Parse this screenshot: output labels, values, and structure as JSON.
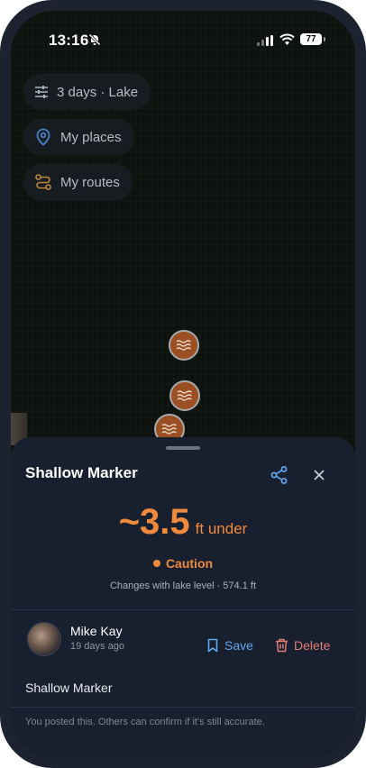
{
  "status": {
    "time": "13:16",
    "battery": "77"
  },
  "filters": [
    {
      "label": "3 days · Lake",
      "icon": "sliders-icon"
    },
    {
      "label": "My places",
      "icon": "pin-icon"
    },
    {
      "label": "My routes",
      "icon": "route-icon"
    }
  ],
  "map_markers": [
    {
      "icon": "waves-icon"
    },
    {
      "icon": "waves-icon"
    },
    {
      "icon": "waves-icon"
    }
  ],
  "sheet": {
    "title": "Shallow Marker",
    "depth_value": "~3.5",
    "depth_unit": "ft under",
    "status": "Caution",
    "changes": "Changes with lake level · 574.1 ft",
    "author": {
      "name": "Mike Kay",
      "ago": "19 days ago"
    },
    "save_label": "Save",
    "delete_label": "Delete",
    "note": "Shallow Marker",
    "footer": "You posted this. Others can confirm if it's still accurate."
  },
  "colors": {
    "accent_orange": "#ef8a3c",
    "save_blue": "#61a7ef",
    "delete_red": "#e27c74",
    "sheet_bg": "#182030",
    "marker_fill": "#9c4f22"
  }
}
